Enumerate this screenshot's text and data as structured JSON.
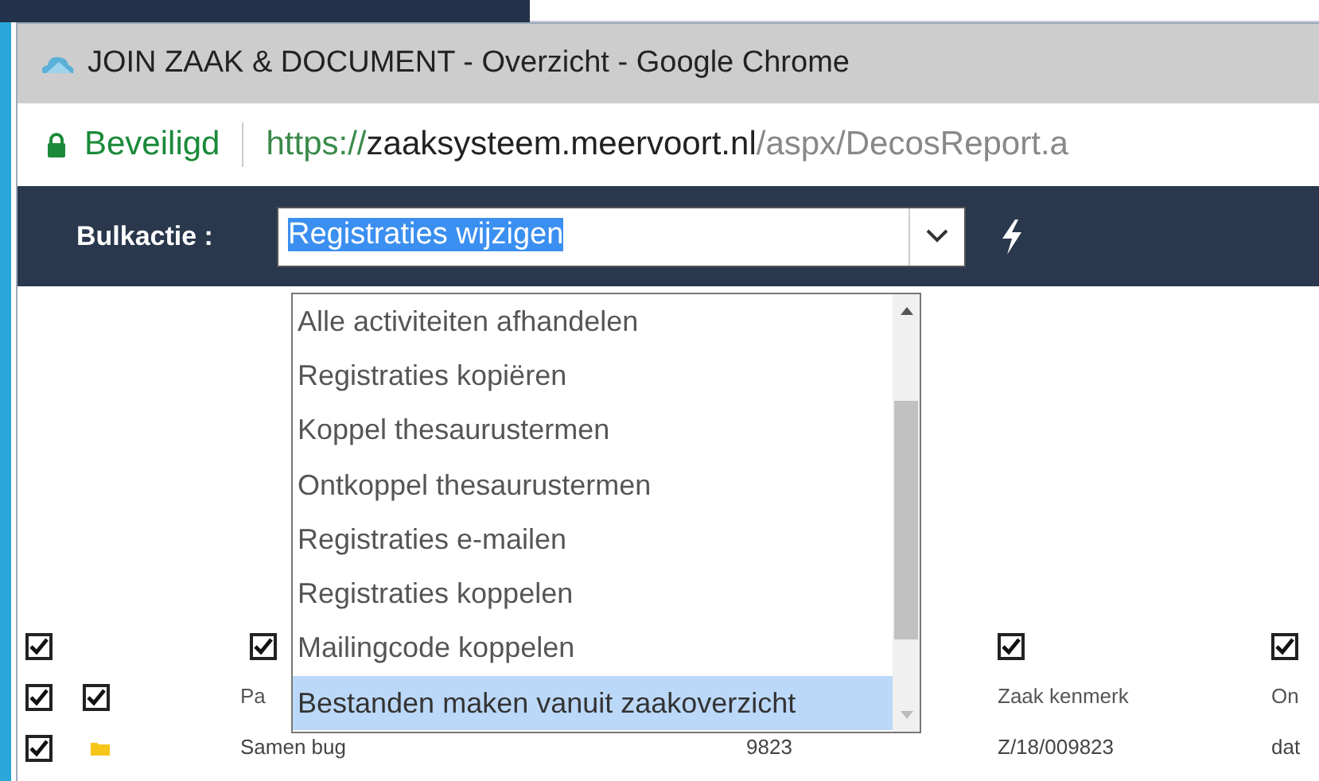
{
  "window": {
    "title": "JOIN ZAAK & DOCUMENT - Overzicht - Google Chrome"
  },
  "address_bar": {
    "security": "Beveiligd",
    "url": {
      "scheme": "https://",
      "host": "zaaksysteem.meervoort.nl",
      "path": "/aspx/DecosReport.a"
    }
  },
  "toolbar": {
    "label": "Bulkactie :",
    "select": {
      "value": "Registraties wijzigen",
      "expanded": true
    }
  },
  "dropdown": {
    "scroll": {
      "level": 0.55
    },
    "options": [
      {
        "label": "Alle activiteiten afhandelen",
        "selected": false
      },
      {
        "label": "Registraties kopiëren",
        "selected": false
      },
      {
        "label": "Koppel thesaurustermen",
        "selected": false
      },
      {
        "label": "Ontkoppel thesaurustermen",
        "selected": false
      },
      {
        "label": "Registraties e-mailen",
        "selected": false
      },
      {
        "label": "Registraties koppelen",
        "selected": false
      },
      {
        "label": "Mailingcode koppelen",
        "selected": false
      },
      {
        "label": "Bestanden maken vanuit zaakoverzicht",
        "selected": true
      }
    ]
  },
  "table": {
    "rows": [
      {
        "cells": [
          {
            "kind": "checkbox",
            "checked": true
          },
          {
            "kind": "empty"
          },
          {
            "kind": "checkbox",
            "checked": true
          },
          {
            "kind": "empty"
          },
          {
            "kind": "checkbox",
            "checked": true
          },
          {
            "kind": "checkbox",
            "checked": true
          }
        ]
      },
      {
        "cells": [
          {
            "kind": "checkbox",
            "checked": true
          },
          {
            "kind": "checkbox",
            "checked": true
          },
          {
            "kind": "heading",
            "text": "Pa"
          },
          {
            "kind": "empty"
          },
          {
            "kind": "heading",
            "text": "Zaak kenmerk"
          },
          {
            "kind": "heading",
            "text": "On"
          }
        ]
      },
      {
        "cells": [
          {
            "kind": "checkbox",
            "checked": true
          },
          {
            "kind": "folder"
          },
          {
            "kind": "text",
            "text": "Samen bug"
          },
          {
            "kind": "text",
            "text": "9823"
          },
          {
            "kind": "text",
            "text": "Z/18/009823"
          },
          {
            "kind": "text",
            "text": "dat"
          }
        ]
      }
    ]
  }
}
